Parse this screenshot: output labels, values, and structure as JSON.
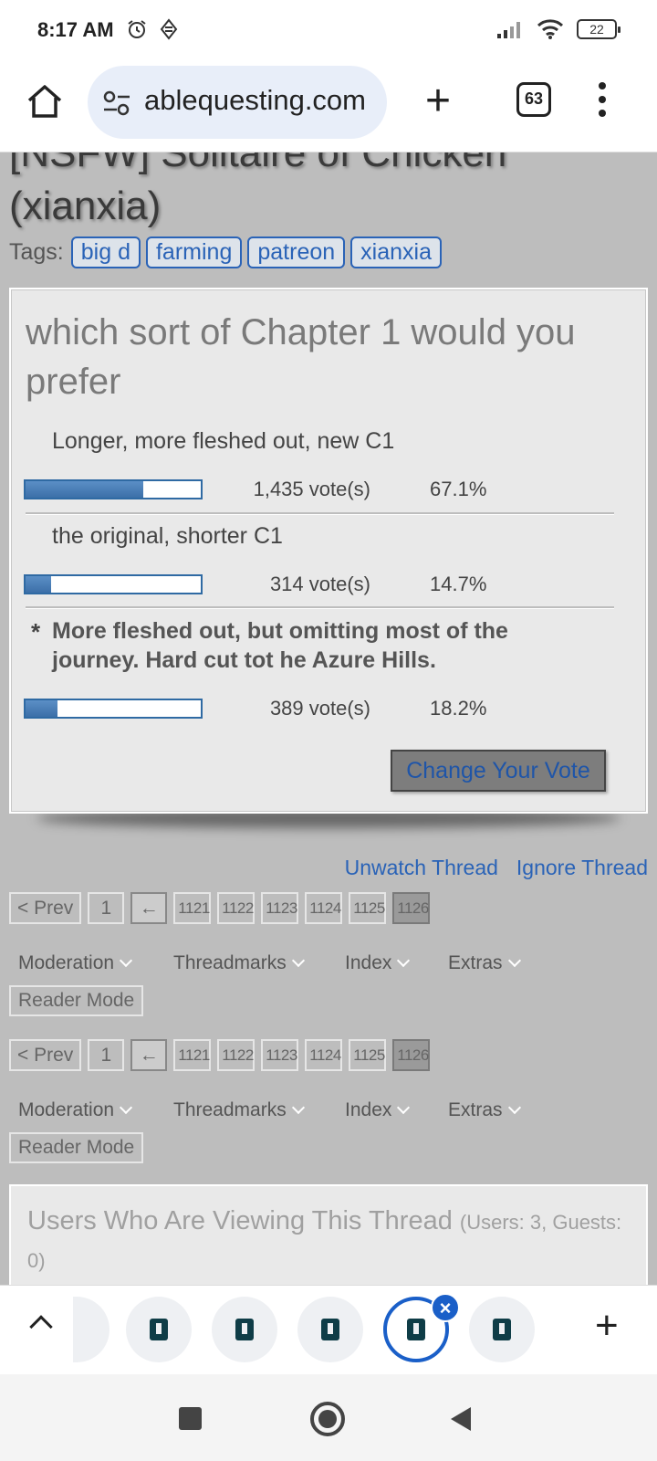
{
  "status": {
    "time": "8:17 AM",
    "battery": "22"
  },
  "browser": {
    "url": "ablequesting.com",
    "tab_count": "63"
  },
  "thread": {
    "title_line1": "[NSFW] Solitaire of Chicken",
    "title_line2": "(xianxia)",
    "tags_label": "Tags:",
    "tags": [
      "big d",
      "farming",
      "patreon",
      "xianxia"
    ]
  },
  "poll": {
    "question": "which sort of Chapter 1 would you prefer",
    "options": [
      {
        "label": "Longer, more fleshed out, new C1",
        "votes": "1,435 vote(s)",
        "percent": "67.1%",
        "fraction": 0.671,
        "selected": false
      },
      {
        "label": "the original, shorter C1",
        "votes": "314 vote(s)",
        "percent": "14.7%",
        "fraction": 0.147,
        "selected": false
      },
      {
        "label": "More fleshed out, but omitting most of the journey. Hard cut tot he Azure Hills.",
        "votes": "389 vote(s)",
        "percent": "18.2%",
        "fraction": 0.182,
        "selected": true,
        "marker": "*"
      }
    ],
    "change_vote_label": "Change Your Vote"
  },
  "thread_links": {
    "unwatch": "Unwatch Thread",
    "ignore": "Ignore Thread"
  },
  "pager": {
    "prev": "< Prev",
    "first": "1",
    "skip": "←",
    "pages": [
      "1121",
      "1122",
      "1123",
      "1124",
      "1125",
      "1126"
    ],
    "current": "1126"
  },
  "thread_menus": {
    "items": [
      "Moderation",
      "Threadmarks",
      "Index",
      "Extras"
    ],
    "reader_mode": "Reader Mode"
  },
  "viewers": {
    "title": "Users Who Are Viewing This Thread",
    "counts": "(Users: 3, Guests: 0)"
  },
  "tab_strip": {
    "close_symbol": "×"
  },
  "colors": {
    "accent": "#2a63b7",
    "bar": "#3c6fa8",
    "page_bg": "#bdbdbd"
  }
}
